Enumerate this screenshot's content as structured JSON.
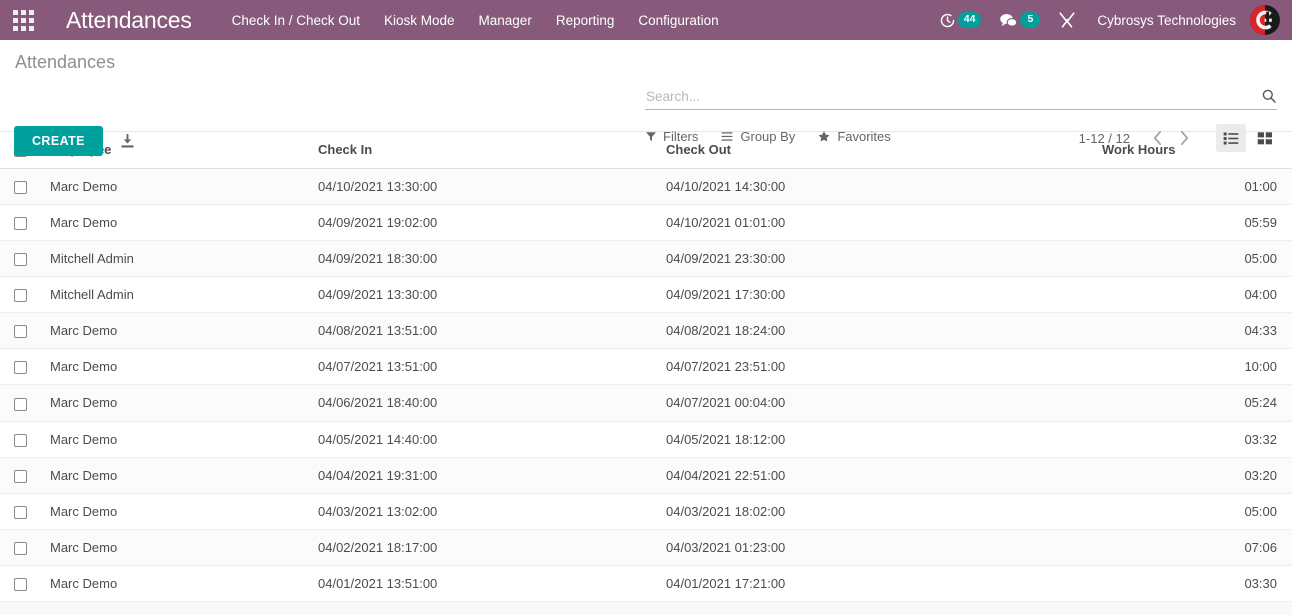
{
  "navbar": {
    "apps_icon": "apps-grid-icon",
    "brand": "Attendances",
    "menu": [
      {
        "label": "Check In / Check Out"
      },
      {
        "label": "Kiosk Mode"
      },
      {
        "label": "Manager"
      },
      {
        "label": "Reporting"
      },
      {
        "label": "Configuration"
      }
    ],
    "activities": {
      "icon": "clock-activity-icon",
      "count": "44"
    },
    "messages": {
      "icon": "chat-bubble-icon",
      "count": "5"
    },
    "debug": {
      "icon": "wrench-tools-icon"
    },
    "company": "Cybrosys Technologies",
    "avatar_icon": "user-avatar-logo",
    "background_color": "#875a7b",
    "badge_color": "#00a09d"
  },
  "control_panel": {
    "title": "Attendances",
    "create_label": "CREATE",
    "import_icon": "import-download-icon",
    "search": {
      "placeholder": "Search...",
      "value": "",
      "icon": "search-magnifier-icon"
    },
    "filters": [
      {
        "label": "Filters",
        "icon": "funnel-icon"
      },
      {
        "label": "Group By",
        "icon": "hamburger-lines-icon"
      },
      {
        "label": "Favorites",
        "icon": "star-icon"
      }
    ],
    "pager": {
      "range": "1-12 / 12",
      "prev_icon": "chevron-left-icon",
      "next_icon": "chevron-right-icon"
    },
    "views": [
      {
        "name": "list",
        "icon": "list-view-icon",
        "active": true
      },
      {
        "name": "kanban",
        "icon": "kanban-view-icon",
        "active": false
      }
    ],
    "create_button_color": "#00a09d"
  },
  "list": {
    "columns": [
      "Employee",
      "Check In",
      "Check Out",
      "Work Hours"
    ],
    "rows": [
      {
        "employee": "Marc Demo",
        "check_in": "04/10/2021 13:30:00",
        "check_out": "04/10/2021 14:30:00",
        "work_hours": "01:00"
      },
      {
        "employee": "Marc Demo",
        "check_in": "04/09/2021 19:02:00",
        "check_out": "04/10/2021 01:01:00",
        "work_hours": "05:59"
      },
      {
        "employee": "Mitchell Admin",
        "check_in": "04/09/2021 18:30:00",
        "check_out": "04/09/2021 23:30:00",
        "work_hours": "05:00"
      },
      {
        "employee": "Mitchell Admin",
        "check_in": "04/09/2021 13:30:00",
        "check_out": "04/09/2021 17:30:00",
        "work_hours": "04:00"
      },
      {
        "employee": "Marc Demo",
        "check_in": "04/08/2021 13:51:00",
        "check_out": "04/08/2021 18:24:00",
        "work_hours": "04:33"
      },
      {
        "employee": "Marc Demo",
        "check_in": "04/07/2021 13:51:00",
        "check_out": "04/07/2021 23:51:00",
        "work_hours": "10:00"
      },
      {
        "employee": "Marc Demo",
        "check_in": "04/06/2021 18:40:00",
        "check_out": "04/07/2021 00:04:00",
        "work_hours": "05:24"
      },
      {
        "employee": "Marc Demo",
        "check_in": "04/05/2021 14:40:00",
        "check_out": "04/05/2021 18:12:00",
        "work_hours": "03:32"
      },
      {
        "employee": "Marc Demo",
        "check_in": "04/04/2021 19:31:00",
        "check_out": "04/04/2021 22:51:00",
        "work_hours": "03:20"
      },
      {
        "employee": "Marc Demo",
        "check_in": "04/03/2021 13:02:00",
        "check_out": "04/03/2021 18:02:00",
        "work_hours": "05:00"
      },
      {
        "employee": "Marc Demo",
        "check_in": "04/02/2021 18:17:00",
        "check_out": "04/03/2021 01:23:00",
        "work_hours": "07:06"
      },
      {
        "employee": "Marc Demo",
        "check_in": "04/01/2021 13:51:00",
        "check_out": "04/01/2021 17:21:00",
        "work_hours": "03:30"
      }
    ]
  }
}
